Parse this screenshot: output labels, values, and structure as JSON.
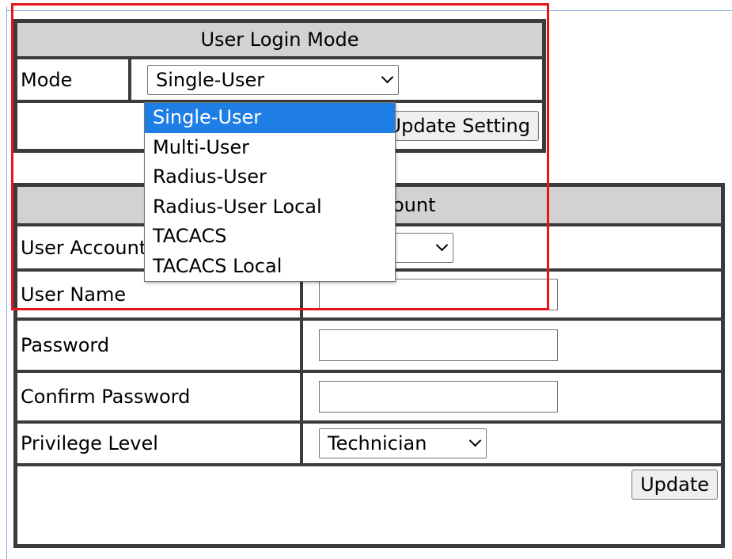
{
  "login_mode": {
    "title": "User Login Mode",
    "mode_label": "Mode",
    "mode_selected": "Single-User",
    "mode_options": [
      "Single-User",
      "Multi-User",
      "Radius-User",
      "Radius-User Local",
      "TACACS",
      "TACACS Local"
    ],
    "update_setting_label": "Update Setting"
  },
  "account": {
    "title_fragment": "ount",
    "user_account_label": "User Account",
    "user_account_value_fragment": "e",
    "user_name_label": "User Name",
    "password_label": "Password",
    "password_value": "",
    "confirm_password_label": "Confirm Password",
    "confirm_password_value": "",
    "privilege_label": "Privilege Level",
    "privilege_value": "Technician",
    "update_label": "Update"
  },
  "colors": {
    "header_bg": "#d2d2d2",
    "selected_option_bg": "#1e7ee6",
    "highlight_border": "#e8131b"
  }
}
